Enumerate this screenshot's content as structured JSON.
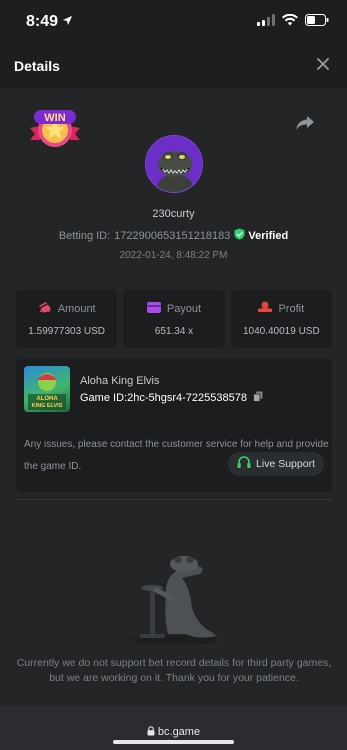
{
  "status_bar": {
    "time": "8:49"
  },
  "header": {
    "title": "Details"
  },
  "bet": {
    "username": "230curty",
    "betting_id_label": "Betting ID:",
    "betting_id": "1722900653151218183",
    "verified_label": "Verified",
    "date": "2022-01-24, 8:48:22 PM"
  },
  "stats": [
    {
      "label": "Amount",
      "value": "1.59977303 USD",
      "icon": "amount-icon"
    },
    {
      "label": "Payout",
      "value": "651.34 x",
      "icon": "payout-card-icon"
    },
    {
      "label": "Profit",
      "value": "1040.40019 USD",
      "icon": "profit-icon"
    }
  ],
  "game": {
    "name": "Aloha King Elvis",
    "thumb_title_1": "ALOHA",
    "thumb_title_2": "KING ELVIS",
    "id_label": "Game ID:",
    "id": "2hc-5hgsr4-7225538578",
    "issue_text": "Any issues, please contact the customer service for help and provide the game ID.",
    "support_label": "Live Support"
  },
  "notice": "Currently we do not support bet record details for third party games, but we are working on it. Thank you for your patience.",
  "browser": {
    "url": "bc.game"
  },
  "win_badge_text": "WIN",
  "colors": {
    "background": "#1f2123",
    "card": "#1b1d1f",
    "verified_green": "#2bd36a",
    "amount_icon": "#e64a6a",
    "payout_icon": "#a94be8",
    "profit_icon": "#e0473a",
    "support_icon": "#3ecf6e",
    "avatar_purple": "#6b2fc7"
  }
}
